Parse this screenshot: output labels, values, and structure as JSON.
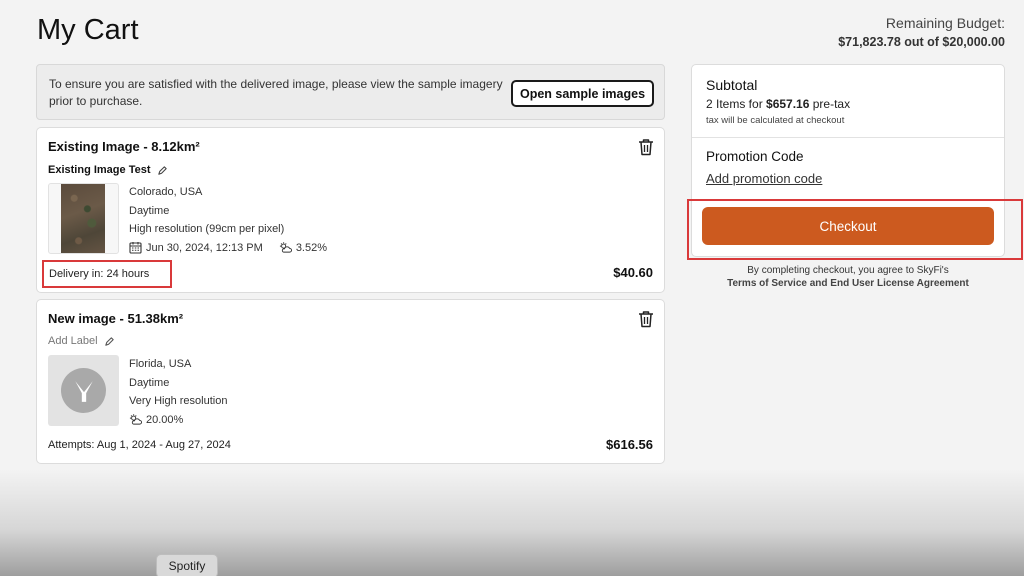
{
  "page": {
    "title": "My Cart"
  },
  "budget": {
    "label": "Remaining Budget:",
    "value": "$71,823.78 out of $20,000.00"
  },
  "notice": {
    "text": "To ensure you are satisfied with the delivered image, please view the sample imagery prior to purchase.",
    "button_label": "Open sample images"
  },
  "cart_items": [
    {
      "title": "Existing Image - 8.12km²",
      "label": "Existing Image Test",
      "location": "Colorado, USA",
      "time_of_day": "Daytime",
      "resolution": "High resolution (99cm per pixel)",
      "date": "Jun 30, 2024, 12:13 PM",
      "cloud_cover": "3.52%",
      "footer": "Delivery in: 24 hours",
      "price": "$40.60"
    },
    {
      "title": "New image - 51.38km²",
      "label": "Add Label",
      "location": "Florida, USA",
      "time_of_day": "Daytime",
      "resolution": "Very High resolution",
      "cloud_cover": "20.00%",
      "footer": "Attempts: Aug 1, 2024 - Aug 27, 2024",
      "price": "$616.56"
    }
  ],
  "summary": {
    "subtotal_title": "Subtotal",
    "items_prefix": "2 Items for ",
    "items_amount": "$657.16",
    "items_suffix": " pre-tax",
    "tax_note": "tax will be calculated at checkout",
    "promo_title": "Promotion Code",
    "promo_link": "Add promotion code",
    "checkout_label": "Checkout",
    "terms_line1": "By completing checkout, you agree to SkyFi's",
    "terms_line2": "Terms of Service and End User License Agreement"
  },
  "dock": {
    "tooltip": "Spotify"
  },
  "colors": {
    "accent": "#cc5a1f",
    "highlight": "#d9393a"
  }
}
